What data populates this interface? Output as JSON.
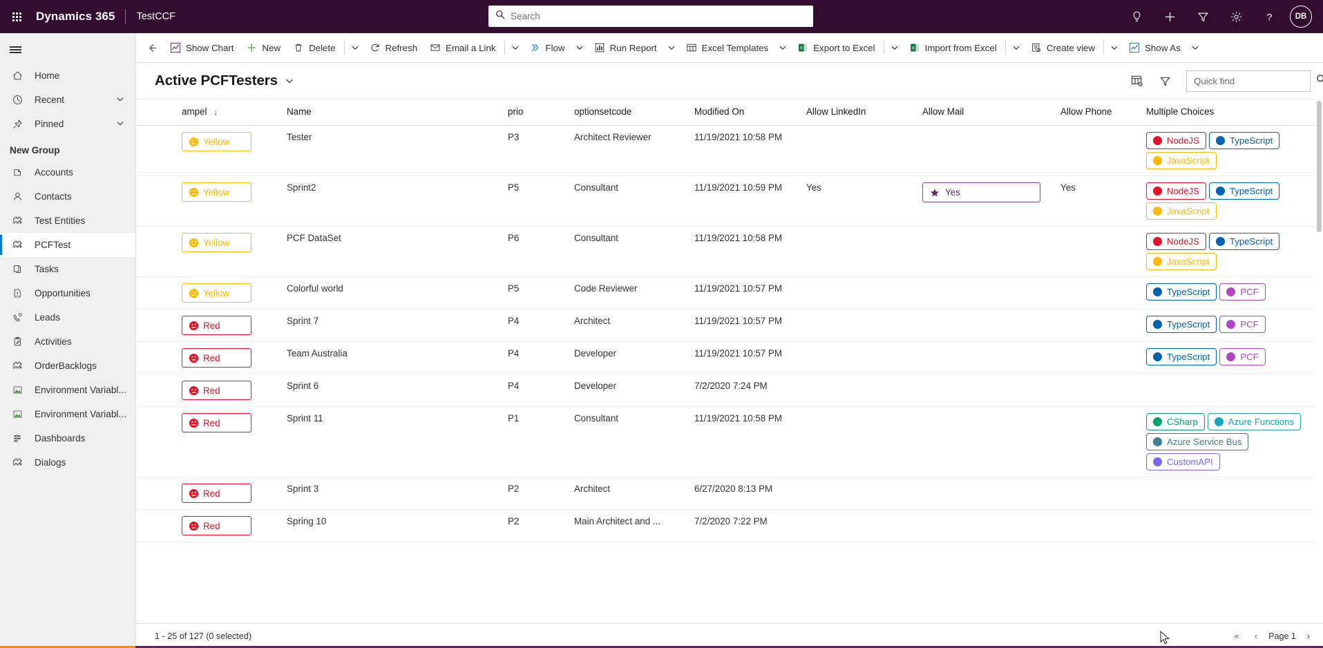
{
  "topbar": {
    "waffle_label": "app-launcher",
    "brand": "Dynamics 365",
    "app_name": "TestCCF",
    "search_placeholder": "Search",
    "search_value": "",
    "avatar_initials": "DB",
    "icons": [
      {
        "name": "lightbulb-icon",
        "label": "Tips"
      },
      {
        "name": "plus-icon",
        "label": "New"
      },
      {
        "name": "filter-icon",
        "label": "Filter"
      },
      {
        "name": "gear-icon",
        "label": "Settings"
      },
      {
        "name": "help-icon",
        "label": "Help"
      }
    ],
    "colors": {
      "bar": "#330b2f",
      "accent": "#0078d4"
    }
  },
  "sidebar": {
    "hamburger_label": "Site Map",
    "top_items": [
      {
        "label": "Home",
        "icon": "home-icon",
        "chevron": false,
        "selected": false
      },
      {
        "label": "Recent",
        "icon": "clock-icon",
        "chevron": true,
        "selected": false
      },
      {
        "label": "Pinned",
        "icon": "pin-icon",
        "chevron": true,
        "selected": false
      }
    ],
    "group_header": "New Group",
    "group_items": [
      {
        "label": "Accounts",
        "icon": "accounts-icon",
        "selected": false,
        "two_line": false
      },
      {
        "label": "Contacts",
        "icon": "contact-icon",
        "selected": false,
        "two_line": false
      },
      {
        "label": "Test Entities",
        "icon": "puzzle-icon",
        "selected": false,
        "two_line": false
      },
      {
        "label": "PCFTest",
        "icon": "puzzle-icon",
        "selected": true,
        "two_line": false
      },
      {
        "label": "Tasks",
        "icon": "pages-icon",
        "selected": false,
        "two_line": false
      },
      {
        "label": "Opportunities",
        "icon": "opportunity-icon",
        "selected": false,
        "two_line": false
      },
      {
        "label": "Leads",
        "icon": "leads-icon",
        "selected": false,
        "two_line": false
      },
      {
        "label": "Activities",
        "icon": "activities-icon",
        "selected": false,
        "two_line": false
      },
      {
        "label": "OrderBacklogs",
        "icon": "puzzle-icon",
        "selected": false,
        "two_line": false
      },
      {
        "label": "Environment Variabl...",
        "icon": "envvar-icon",
        "selected": false,
        "two_line": true
      },
      {
        "label": "Environment Variabl...",
        "icon": "envvar-icon",
        "selected": false,
        "two_line": true
      },
      {
        "label": "Dashboards",
        "icon": "dashboards-icon",
        "selected": false,
        "two_line": false
      },
      {
        "label": "Dialogs",
        "icon": "puzzle-icon",
        "selected": false,
        "two_line": false
      }
    ]
  },
  "commandbar": {
    "back_label": "Back",
    "buttons": [
      {
        "label": "Show Chart",
        "icon": "chart-icon",
        "caret": false,
        "divider_after": false
      },
      {
        "label": "New",
        "icon": "plus-icon",
        "caret": false,
        "divider_after": false
      },
      {
        "label": "Delete",
        "icon": "trash-icon",
        "caret": true,
        "divider_before": true,
        "divider_after": false
      },
      {
        "label": "Refresh",
        "icon": "refresh-icon",
        "caret": false,
        "divider_after": false
      },
      {
        "label": "Email a Link",
        "icon": "email-icon",
        "caret": true,
        "divider_before": true,
        "divider_after": false
      },
      {
        "label": "Flow",
        "icon": "flow-icon",
        "caret": true,
        "divider_after": false
      },
      {
        "label": "Run Report",
        "icon": "report-icon",
        "caret": true,
        "divider_after": false
      },
      {
        "label": "Excel Templates",
        "icon": "excel-template-icon",
        "caret": true,
        "divider_after": false
      },
      {
        "label": "Export to Excel",
        "icon": "excel-icon",
        "caret": true,
        "divider_before": true,
        "divider_after": false
      },
      {
        "label": "Import from Excel",
        "icon": "excel-icon",
        "caret": true,
        "divider_before": true,
        "divider_after": false
      },
      {
        "label": "Create view",
        "icon": "createview-icon",
        "caret": true,
        "divider_before": true,
        "divider_after": false
      },
      {
        "label": "Show As",
        "icon": "showas-icon",
        "caret": true,
        "divider_after": false
      }
    ]
  },
  "viewheader": {
    "title": "Active PCFTesters",
    "title_caret_label": "change-view",
    "edit_columns_label": "Edit columns",
    "edit_filters_label": "Edit filters",
    "quickfind_placeholder": "Quick find",
    "quickfind_value": ""
  },
  "grid": {
    "columns": [
      {
        "key": "ampel",
        "label": "ampel",
        "sorted": true,
        "sort_dir": "desc"
      },
      {
        "key": "name",
        "label": "Name",
        "sorted": false
      },
      {
        "key": "prio",
        "label": "prio",
        "sorted": false
      },
      {
        "key": "optionsetcode",
        "label": "optionsetcode",
        "sorted": false
      },
      {
        "key": "modified",
        "label": "Modified On",
        "sorted": false
      },
      {
        "key": "linkedin",
        "label": "Allow LinkedIn",
        "sorted": false
      },
      {
        "key": "mail",
        "label": "Allow Mail",
        "sorted": false
      },
      {
        "key": "phone",
        "label": "Allow Phone",
        "sorted": false
      },
      {
        "key": "multiple",
        "label": "Multiple Choices",
        "sorted": false
      }
    ],
    "rows": [
      {
        "ampel": {
          "label": "Yellow",
          "tone": "yellow"
        },
        "name": "Tester",
        "prio": "P3",
        "optionsetcode": "Architect Reviewer",
        "modified": "11/19/2021 10:58 PM",
        "linkedin": "",
        "mail": "",
        "mail_focused": false,
        "phone": "",
        "multiple": [
          {
            "label": "NodeJS",
            "color": "#e81123"
          },
          {
            "label": "TypeScript",
            "color": "#0063b1"
          },
          {
            "label": "JavaScript",
            "color": "#ffb900"
          }
        ]
      },
      {
        "ampel": {
          "label": "Yellow",
          "tone": "yellow"
        },
        "name": "Sprint2",
        "prio": "P5",
        "optionsetcode": "Consultant",
        "modified": "11/19/2021 10:59 PM",
        "linkedin": "Yes",
        "mail": "Yes",
        "mail_focused": true,
        "phone": "Yes",
        "multiple": [
          {
            "label": "NodeJS",
            "color": "#e81123"
          },
          {
            "label": "TypeScript",
            "color": "#0063b1"
          },
          {
            "label": "JavaScript",
            "color": "#ffb900"
          }
        ]
      },
      {
        "ampel": {
          "label": "Yellow",
          "tone": "yellow"
        },
        "name": "PCF DataSet",
        "prio": "P6",
        "optionsetcode": "Consultant",
        "modified": "11/19/2021 10:58 PM",
        "linkedin": "",
        "mail": "",
        "mail_focused": false,
        "phone": "",
        "multiple": [
          {
            "label": "NodeJS",
            "color": "#e81123"
          },
          {
            "label": "TypeScript",
            "color": "#0063b1"
          },
          {
            "label": "JavaScript",
            "color": "#ffb900"
          }
        ]
      },
      {
        "ampel": {
          "label": "Yellow",
          "tone": "yellow"
        },
        "name": "Colorful world",
        "prio": "P5",
        "optionsetcode": "Code Reviewer",
        "modified": "11/19/2021 10:57 PM",
        "linkedin": "",
        "mail": "",
        "mail_focused": false,
        "phone": "",
        "multiple": [
          {
            "label": "TypeScript",
            "color": "#0063b1"
          },
          {
            "label": "PCF",
            "color": "#b146c2"
          }
        ]
      },
      {
        "ampel": {
          "label": "Red",
          "tone": "red"
        },
        "name": "Sprint 7",
        "prio": "P4",
        "optionsetcode": "Architect",
        "modified": "11/19/2021 10:57 PM",
        "linkedin": "",
        "mail": "",
        "mail_focused": false,
        "phone": "",
        "multiple": [
          {
            "label": "TypeScript",
            "color": "#0063b1"
          },
          {
            "label": "PCF",
            "color": "#b146c2"
          }
        ]
      },
      {
        "ampel": {
          "label": "Red",
          "tone": "red"
        },
        "name": "Team Australia",
        "prio": "P4",
        "optionsetcode": "Developer",
        "modified": "11/19/2021 10:57 PM",
        "linkedin": "",
        "mail": "",
        "mail_focused": false,
        "phone": "",
        "multiple": [
          {
            "label": "TypeScript",
            "color": "#0063b1"
          },
          {
            "label": "PCF",
            "color": "#b146c2"
          }
        ]
      },
      {
        "ampel": {
          "label": "Red",
          "tone": "red"
        },
        "name": "Sprint 6",
        "prio": "P4",
        "optionsetcode": "Developer",
        "modified": "7/2/2020 7:24 PM",
        "linkedin": "",
        "mail": "",
        "mail_focused": false,
        "phone": "",
        "multiple": []
      },
      {
        "ampel": {
          "label": "Red",
          "tone": "red"
        },
        "name": "Sprint 11",
        "prio": "P1",
        "optionsetcode": "Consultant",
        "modified": "11/19/2021 10:58 PM",
        "linkedin": "",
        "mail": "",
        "mail_focused": false,
        "phone": "",
        "multiple": [
          {
            "label": "CSharp",
            "color": "#00a36c"
          },
          {
            "label": "Azure Functions",
            "color": "#19a3bd"
          },
          {
            "label": "Azure Service Bus",
            "color": "#3b7f8f"
          },
          {
            "label": "CustomAPI",
            "color": "#7b68ee"
          }
        ]
      },
      {
        "ampel": {
          "label": "Red",
          "tone": "red"
        },
        "name": "Sprint 3",
        "prio": "P2",
        "optionsetcode": "Architect",
        "modified": "6/27/2020 8:13 PM",
        "linkedin": "",
        "mail": "",
        "mail_focused": false,
        "phone": "",
        "multiple": []
      },
      {
        "ampel": {
          "label": "Red",
          "tone": "red"
        },
        "name": "Spring 10",
        "prio": "P2",
        "optionsetcode": "Main Architect and ...",
        "modified": "7/2/2020 7:22 PM",
        "linkedin": "",
        "mail": "",
        "mail_focused": false,
        "phone": "",
        "multiple": []
      }
    ]
  },
  "footer": {
    "record_count": "1 - 25 of 127 (0 selected)",
    "page_label": "Page 1",
    "first_label": "First page",
    "prev_label": "Previous page",
    "next_label": "Next page"
  }
}
